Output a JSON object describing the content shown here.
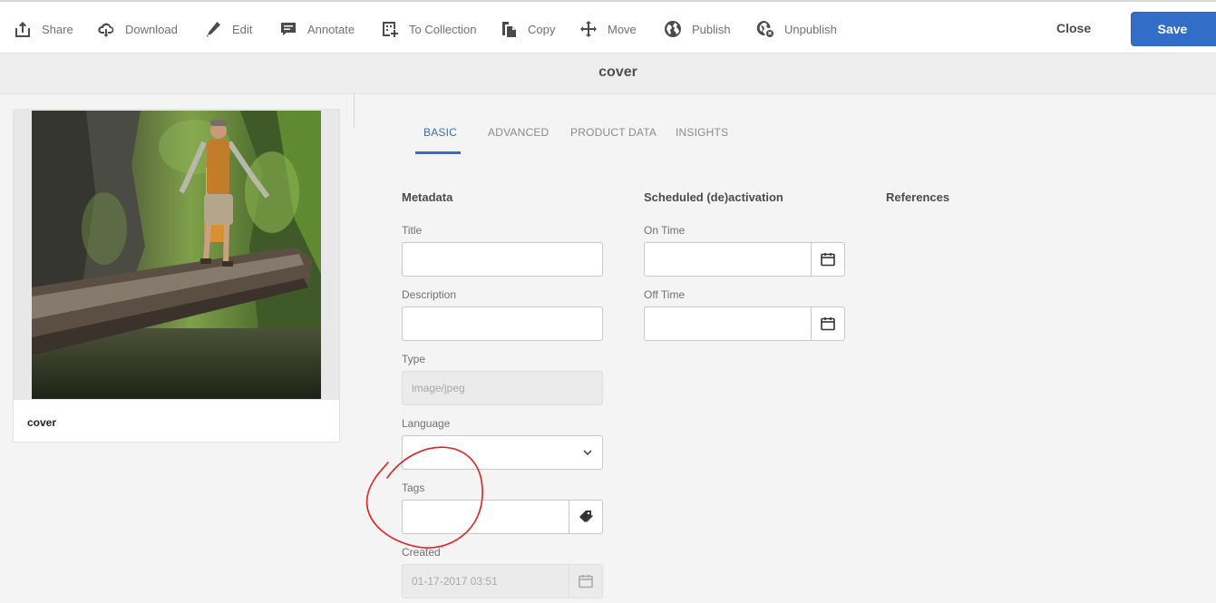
{
  "toolbar": {
    "share": "Share",
    "download": "Download",
    "edit": "Edit",
    "annotate": "Annotate",
    "to_collection": "To Collection",
    "copy": "Copy",
    "move": "Move",
    "publish": "Publish",
    "unpublish": "Unpublish",
    "close": "Close",
    "save": "Save"
  },
  "page": {
    "title": "cover"
  },
  "asset_card": {
    "label": "cover"
  },
  "tabs": [
    {
      "label": "BASIC",
      "active": true
    },
    {
      "label": "ADVANCED",
      "active": false
    },
    {
      "label": "PRODUCT DATA",
      "active": false
    },
    {
      "label": "INSIGHTS",
      "active": false
    }
  ],
  "metadata": {
    "heading": "Metadata",
    "title_label": "Title",
    "title_value": "",
    "description_label": "Description",
    "description_value": "",
    "type_label": "Type",
    "type_value": "image/jpeg",
    "language_label": "Language",
    "language_value": "",
    "tags_label": "Tags",
    "tags_value": "",
    "created_label": "Created",
    "created_value": "01-17-2017 03:51"
  },
  "scheduled": {
    "heading": "Scheduled (de)activation",
    "on_time_label": "On Time",
    "on_time_value": "",
    "off_time_label": "Off Time",
    "off_time_value": ""
  },
  "references": {
    "heading": "References"
  },
  "colors": {
    "accent": "#326ec8",
    "annotation": "#e02020"
  }
}
